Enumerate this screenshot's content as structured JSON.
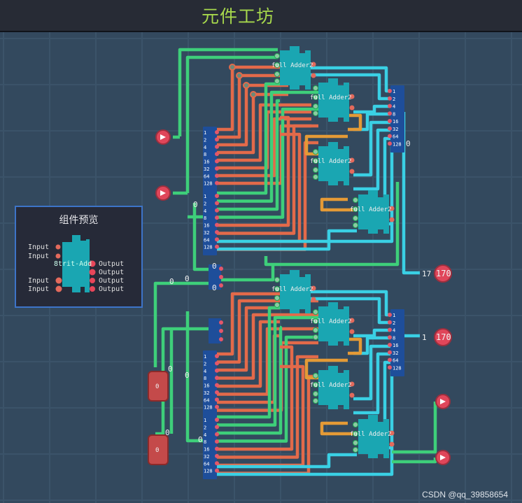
{
  "app": {
    "title": "元件工坊"
  },
  "preview": {
    "title": "组件预览",
    "component_name": "8trit-Add",
    "inputs": [
      "Input",
      "Input",
      "Input",
      "Input"
    ],
    "outputs": [
      "Output",
      "Output",
      "Output",
      "Output"
    ]
  },
  "circuit": {
    "adder_label": "full Adder2",
    "split_bits": [
      "1",
      "2",
      "4",
      "8",
      "16",
      "32",
      "64",
      "128"
    ],
    "output_values": [
      "170",
      "170"
    ],
    "output_prefixes": [
      "17",
      "1"
    ],
    "zero_value": "0",
    "input_value": "0"
  },
  "watermark": "CSDN @qq_39858654",
  "colors": {
    "wire_green": "#3ecf7a",
    "wire_orange": "#e36a4a",
    "wire_cyan": "#3ad0e4",
    "wire_amber": "#e49a36",
    "adder": "#1aa6b2",
    "bus": "#1e4e9a",
    "pin_red": "#e0465a"
  }
}
